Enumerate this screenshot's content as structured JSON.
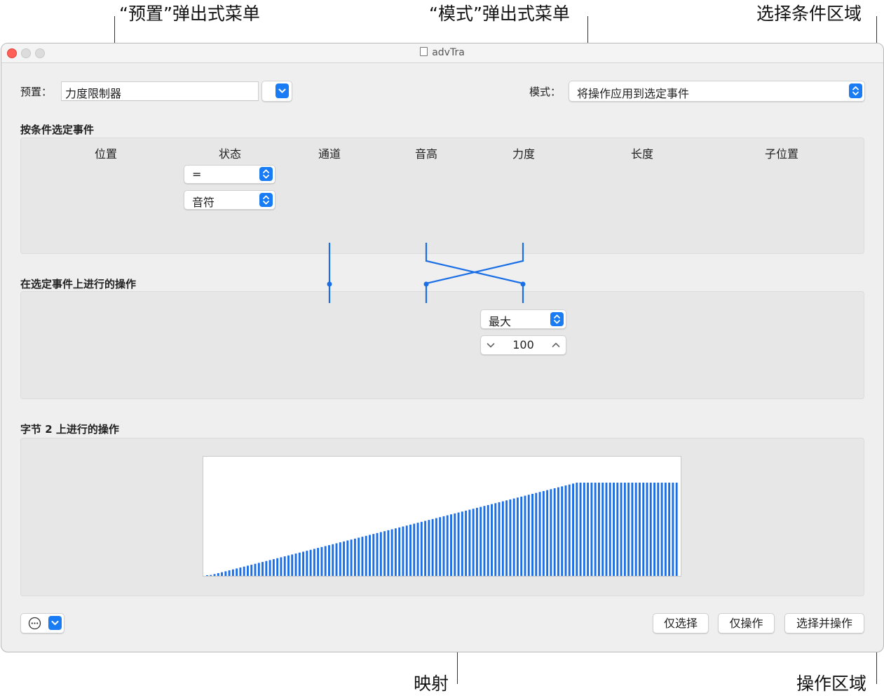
{
  "callouts": {
    "preset_menu": "“预置”弹出式菜单",
    "mode_menu": "“模式”弹出式菜单",
    "condition_area": "选择条件区域",
    "mapping": "映射",
    "operation_area": "操作区域"
  },
  "window": {
    "title": "advTra",
    "doc_icon": "document-icon"
  },
  "preset": {
    "label": "预置：",
    "value": "力度限制器"
  },
  "mode": {
    "label": "模式：",
    "value": "将操作应用到选定事件"
  },
  "select_section": {
    "title": "按条件选定事件",
    "columns": [
      "位置",
      "状态",
      "通道",
      "音高",
      "力度",
      "长度",
      "子位置"
    ],
    "status_operator": "=",
    "status_type": "音符"
  },
  "operation_section": {
    "title": "在选定事件上进行的操作",
    "velocity_operation": "最大",
    "velocity_value": "100"
  },
  "byte2_section": {
    "title": "字节 2 上进行的操作"
  },
  "mapping_chart": {
    "points": 128,
    "slope_until": 100,
    "max_value": 127,
    "bar_color": "#1a6fe6"
  },
  "buttons": {
    "more_icon": "ellipsis-circle-icon",
    "select_only": "仅选择",
    "operate_only": "仅操作",
    "select_and_operate": "选择并操作"
  },
  "colors": {
    "accent": "#1a7cf4",
    "close": "#fe5f57",
    "inactive_light": "#dcdcdc"
  }
}
